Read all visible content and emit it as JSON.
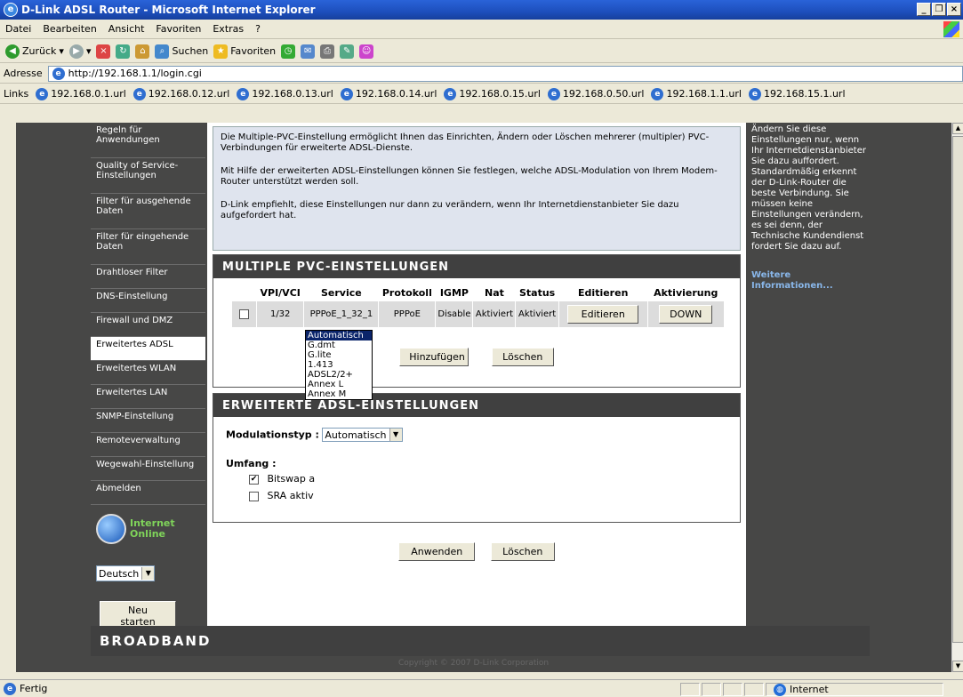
{
  "window": {
    "title": "D-Link ADSL Router - Microsoft Internet Explorer"
  },
  "menu": [
    "Datei",
    "Bearbeiten",
    "Ansicht",
    "Favoriten",
    "Extras",
    "?"
  ],
  "toolbar": {
    "back": "Zurück",
    "search": "Suchen",
    "favorites": "Favoriten"
  },
  "address": {
    "label": "Adresse",
    "url": "http://192.168.1.1/login.cgi"
  },
  "links": {
    "label": "Links",
    "items": [
      "192.168.0.1.url",
      "192.168.0.12.url",
      "192.168.0.13.url",
      "192.168.0.14.url",
      "192.168.0.15.url",
      "192.168.0.50.url",
      "192.168.1.1.url",
      "192.168.15.1.url"
    ]
  },
  "sidebar": {
    "items": [
      "Regeln für Anwendungen",
      "Quality of Service-Einstellungen",
      "Filter für ausgehende Daten",
      "Filter für eingehende Daten",
      "Drahtloser Filter",
      "DNS-Einstellung",
      "Firewall und DMZ",
      "Erweitertes ADSL",
      "Erweitertes WLAN",
      "Erweitertes LAN",
      "SNMP-Einstellung",
      "Remoteverwaltung",
      "Wegewahl-Einstellung",
      "Abmelden"
    ],
    "status_line1": "Internet",
    "status_line2": "Online",
    "language": "Deutsch",
    "reboot": "Neu starten"
  },
  "intro": {
    "p1": "Die Multiple-PVC-Einstellung ermöglicht Ihnen das Einrichten, Ändern oder Löschen mehrerer (multipler) PVC-Verbindungen für erweiterte ADSL-Dienste.",
    "p2": "Mit Hilfe der erweiterten ADSL-Einstellungen können Sie festlegen, welche ADSL-Modulation von Ihrem Modem-Router unterstützt werden soll.",
    "p3": "D-Link empfiehlt, diese Einstellungen nur dann zu verändern, wenn Ihr Internetdienstanbieter Sie dazu aufgefordert hat."
  },
  "pvc": {
    "title": "MULTIPLE PVC-EINSTELLUNGEN",
    "columns": [
      "VPI/VCI",
      "Service",
      "Protokoll",
      "IGMP",
      "Nat",
      "Status",
      "Editieren",
      "Aktivierung"
    ],
    "rows": [
      {
        "vpi_vci": "1/32",
        "service": "PPPoE_1_32_1",
        "protokoll": "PPPoE",
        "igmp": "Disable",
        "nat": "Aktiviert",
        "status": "Aktiviert",
        "edit": "Editieren",
        "activation": "DOWN"
      }
    ],
    "add": "Hinzufügen",
    "delete": "Löschen"
  },
  "adsl": {
    "title": "ERWEITERTE ADSL-EINSTELLUNGEN",
    "modulation_label": "Modulationstyp :",
    "modulation_value": "Automatisch",
    "options": [
      "Automatisch",
      "G.dmt",
      "G.lite",
      "1.413",
      "ADSL2/2+",
      "Annex L",
      "Annex M"
    ],
    "scope_label": "Umfang :",
    "bitswap": "Bitswap a",
    "sra": "SRA aktiv",
    "apply": "Anwenden",
    "delete": "Löschen"
  },
  "help": {
    "text": "Ändern Sie diese Einstellungen nur, wenn Ihr Internetdienstanbieter Sie dazu auffordert. Standardmäßig erkennt der D-Link-Router die beste Verbindung. Sie müssen keine Einstellungen verändern, es sei denn, der Technische Kundendienst fordert Sie dazu auf.",
    "more": "Weitere Informationen..."
  },
  "footer": {
    "brand": "BROADBAND",
    "copyright": "Copyright © 2007 D-Link Corporation"
  },
  "status": {
    "text": "Fertig",
    "zone": "Internet"
  }
}
